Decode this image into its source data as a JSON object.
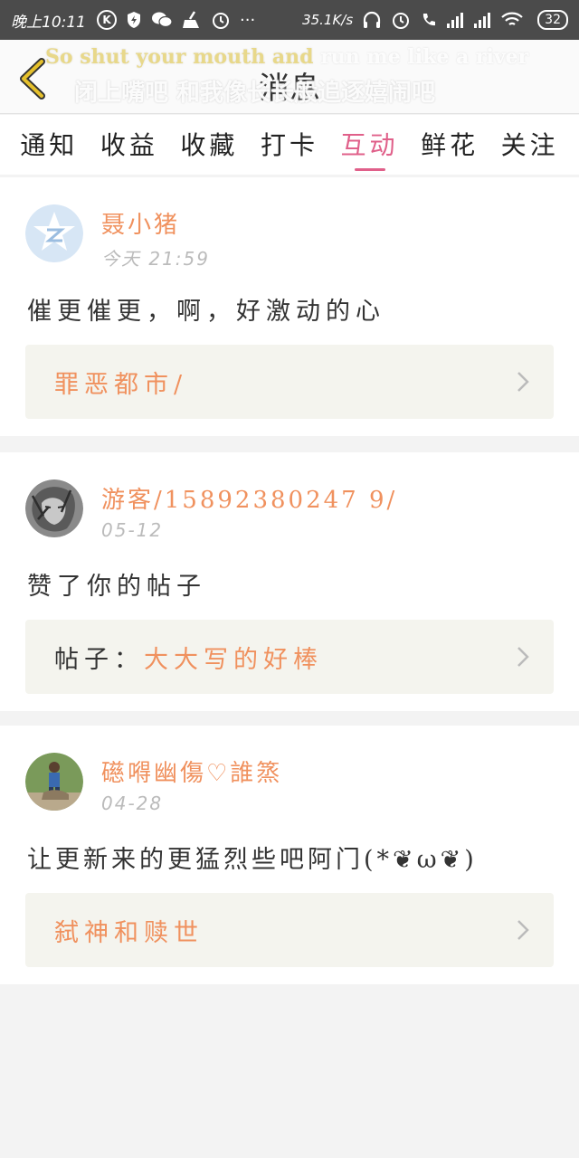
{
  "status_bar": {
    "time": "晚上10:11",
    "speed": "35.1K/s",
    "battery": "32",
    "icons": [
      "k-icon",
      "shield-icon",
      "wechat-icon",
      "broom-icon",
      "alarm-icon",
      "more-dots-icon",
      "headphones-icon",
      "alarm-icon",
      "call-icon",
      "signal-icon",
      "signal-icon",
      "wifi-icon",
      "battery-icon"
    ]
  },
  "header": {
    "title": "消息",
    "lyric_en_highlight": "So shut your mouth and",
    "lyric_en_rest": " run me like a river",
    "lyric_zh": "闭上嘴吧 和我像长长般追逐嬉闹吧"
  },
  "tabs": [
    {
      "label": "通知",
      "active": false
    },
    {
      "label": "收益",
      "active": false
    },
    {
      "label": "收藏",
      "active": false
    },
    {
      "label": "打卡",
      "active": false
    },
    {
      "label": "互动",
      "active": true
    },
    {
      "label": "鲜花",
      "active": false
    },
    {
      "label": "关注",
      "active": false
    }
  ],
  "colors": {
    "accent_pink": "#e0608a",
    "accent_orange": "#f0915e",
    "back_arrow": "#e5c02b"
  },
  "messages": [
    {
      "user": "聂小猪",
      "date": "今天 21:59",
      "text": "催更催更，啊，好激动的心",
      "ref_prefix": "",
      "ref_title": "罪恶都市/"
    },
    {
      "user": "游客/15892380247 9/",
      "date": "05-12",
      "text": "赞了你的帖子",
      "ref_prefix": "帖子：",
      "ref_title": "大大写的好棒"
    },
    {
      "user": "礠嘚幽傷♡誰篜",
      "date": "04-28",
      "text": "让更新来的更猛烈些吧阿门(*❦ω❦)",
      "ref_prefix": "",
      "ref_title": "弑神和赎世"
    }
  ]
}
